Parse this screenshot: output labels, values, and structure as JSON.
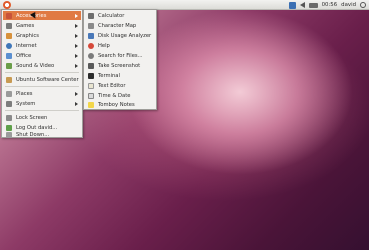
{
  "panel": {
    "clock": "00:56",
    "user": "david",
    "tray_icons": [
      "mail-icon",
      "sound-icon",
      "battery-icon",
      "power-icon"
    ]
  },
  "main_menu": {
    "items": [
      {
        "label": "Accessories",
        "icon": "accessories-icon",
        "has_submenu": true,
        "highlighted": true
      },
      {
        "label": "Games",
        "icon": "games-icon",
        "has_submenu": true
      },
      {
        "label": "Graphics",
        "icon": "graphics-icon",
        "has_submenu": true
      },
      {
        "label": "Internet",
        "icon": "internet-icon",
        "has_submenu": true
      },
      {
        "label": "Office",
        "icon": "office-icon",
        "has_submenu": true
      },
      {
        "label": "Sound & Video",
        "icon": "sound-video-icon",
        "has_submenu": true
      },
      {
        "label": "Ubuntu Software Center",
        "icon": "software-center-icon",
        "has_submenu": false
      },
      {
        "label": "Places",
        "icon": "places-icon",
        "has_submenu": true
      },
      {
        "label": "System",
        "icon": "system-icon",
        "has_submenu": true
      },
      {
        "label": "Lock Screen",
        "icon": "lock-screen-icon",
        "has_submenu": false
      },
      {
        "label": "Log Out david...",
        "icon": "log-out-icon",
        "has_submenu": false
      },
      {
        "label": "Shut Down...",
        "icon": "shut-down-icon",
        "has_submenu": false
      }
    ]
  },
  "accessories_submenu": {
    "items": [
      {
        "label": "Calculator",
        "icon": "calculator-icon"
      },
      {
        "label": "Character Map",
        "icon": "character-map-icon"
      },
      {
        "label": "Disk Usage Analyzer",
        "icon": "disk-usage-icon"
      },
      {
        "label": "Help",
        "icon": "help-icon"
      },
      {
        "label": "Search for Files...",
        "icon": "search-files-icon"
      },
      {
        "label": "Take Screenshot",
        "icon": "screenshot-icon"
      },
      {
        "label": "Terminal",
        "icon": "terminal-icon"
      },
      {
        "label": "Text Editor",
        "icon": "text-editor-icon"
      },
      {
        "label": "Time & Date",
        "icon": "time-date-icon"
      },
      {
        "label": "Tomboy Notes",
        "icon": "tomboy-notes-icon"
      }
    ]
  },
  "colors": {
    "highlight": "#e07a44",
    "panel": "#e6e6e3",
    "menu_bg": "#f2f1ef"
  }
}
